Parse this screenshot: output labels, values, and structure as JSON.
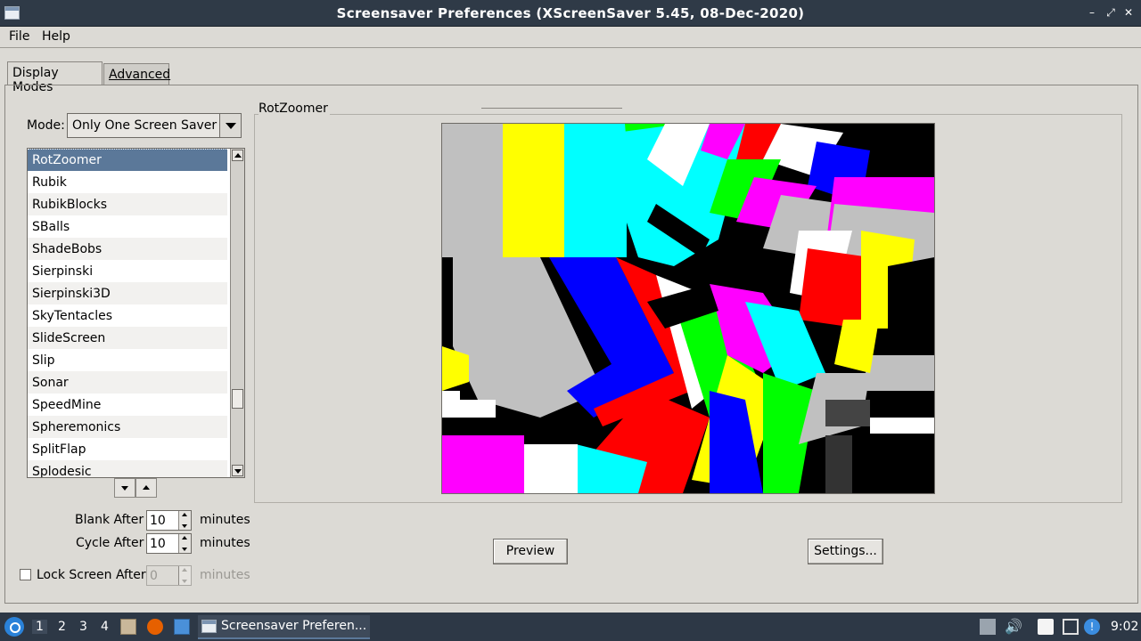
{
  "window": {
    "title": "Screensaver Preferences  (XScreenSaver 5.45, 08-Dec-2020)",
    "controls": [
      "minimize-icon",
      "maximize-icon",
      "close-icon"
    ]
  },
  "menubar": {
    "file": "File",
    "help": "Help"
  },
  "tabs": [
    {
      "label": "Display Modes",
      "active": true
    },
    {
      "label": "Advanced",
      "active": false
    }
  ],
  "mode": {
    "label": "Mode:",
    "value": "Only One Screen Saver"
  },
  "savers": [
    "RotZoomer",
    "Rubik",
    "RubikBlocks",
    "SBalls",
    "ShadeBobs",
    "Sierpinski",
    "Sierpinski3D",
    "SkyTentacles",
    "SlideScreen",
    "Slip",
    "Sonar",
    "SpeedMine",
    "Spheremonics",
    "SplitFlap",
    "Splodesic"
  ],
  "selected_saver": "RotZoomer",
  "timing": {
    "blank_label": "Blank After",
    "blank_value": "10",
    "blank_unit": "minutes",
    "cycle_label": "Cycle After",
    "cycle_value": "10",
    "cycle_unit": "minutes",
    "lock_label": "Lock Screen After",
    "lock_value": "0",
    "lock_unit": "minutes",
    "lock_checked": false
  },
  "preview": {
    "frame_title": "RotZoomer",
    "preview_button": "Preview",
    "settings_button": "Settings..."
  },
  "taskbar": {
    "workspaces": [
      "1",
      "2",
      "3",
      "4"
    ],
    "current_workspace": "1",
    "task_label": "Screensaver Preferen...",
    "clock": "9:02"
  }
}
